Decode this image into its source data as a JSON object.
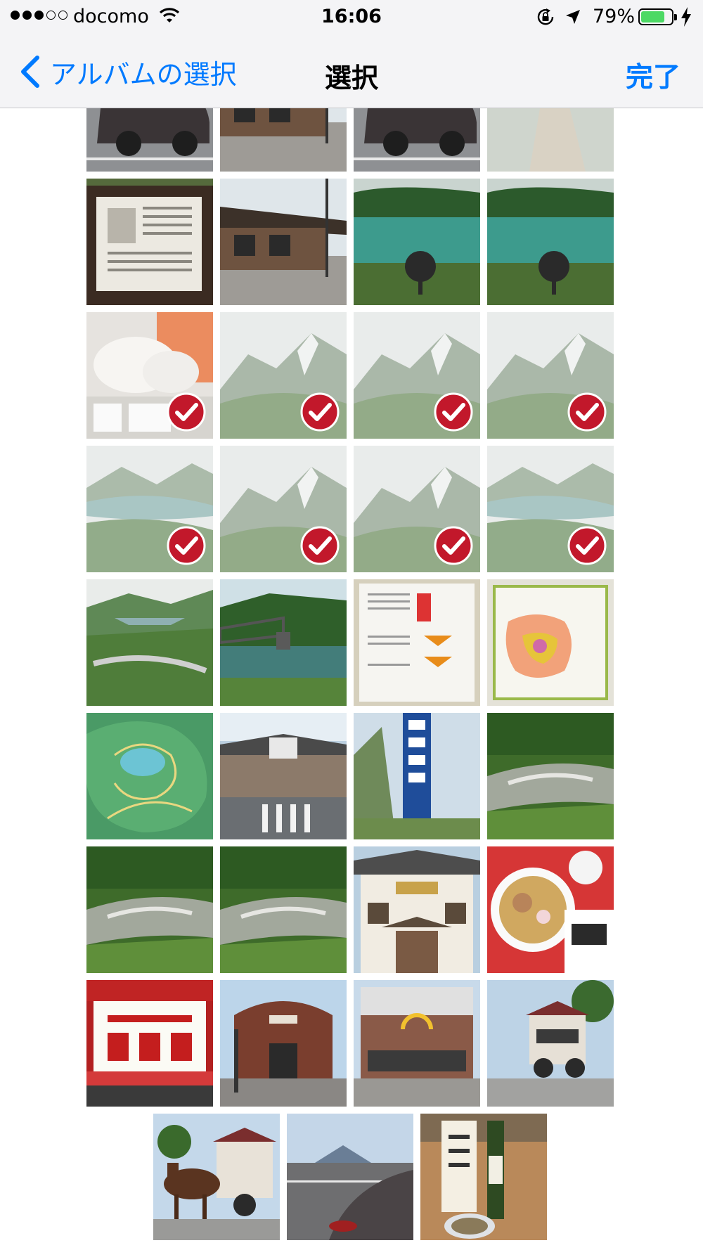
{
  "status_bar": {
    "carrier": "docomo",
    "signal_bars_filled": 3,
    "signal_bars_total": 5,
    "time": "16:06",
    "battery_percent_label": "79%",
    "battery_level": 0.79
  },
  "nav": {
    "back_label": "アルバムの選択",
    "title": "選択",
    "done_label": "完了"
  },
  "colors": {
    "accent": "#007aff",
    "check_badge": "#c2182b",
    "battery_green": "#4cd964"
  },
  "photos": [
    {
      "scene": "car",
      "selected": false
    },
    {
      "scene": "building",
      "selected": false
    },
    {
      "scene": "car",
      "selected": false
    },
    {
      "scene": "path",
      "selected": false
    },
    {
      "scene": "signboard",
      "selected": false
    },
    {
      "scene": "building",
      "selected": false
    },
    {
      "scene": "lake",
      "selected": false
    },
    {
      "scene": "lake",
      "selected": false
    },
    {
      "scene": "bags",
      "selected": true
    },
    {
      "scene": "mountain",
      "selected": true
    },
    {
      "scene": "mountain",
      "selected": true
    },
    {
      "scene": "mountain",
      "selected": true
    },
    {
      "scene": "mountain-lake",
      "selected": true
    },
    {
      "scene": "mountain",
      "selected": true
    },
    {
      "scene": "mountain",
      "selected": true
    },
    {
      "scene": "mountain-lake",
      "selected": true
    },
    {
      "scene": "valley",
      "selected": false
    },
    {
      "scene": "bridge",
      "selected": false
    },
    {
      "scene": "poster",
      "selected": false
    },
    {
      "scene": "map-poster",
      "selected": false
    },
    {
      "scene": "relief-map",
      "selected": false
    },
    {
      "scene": "station",
      "selected": false
    },
    {
      "scene": "tall-sign",
      "selected": false
    },
    {
      "scene": "river",
      "selected": false
    },
    {
      "scene": "river",
      "selected": false
    },
    {
      "scene": "river",
      "selected": false
    },
    {
      "scene": "inn",
      "selected": false
    },
    {
      "scene": "ramen",
      "selected": false
    },
    {
      "scene": "restaurant-sign",
      "selected": false
    },
    {
      "scene": "brick-station",
      "selected": false
    },
    {
      "scene": "shop",
      "selected": false
    },
    {
      "scene": "carriage",
      "selected": false
    },
    {
      "scene": "horse-carriage",
      "selected": false
    },
    {
      "scene": "road-car",
      "selected": false
    },
    {
      "scene": "sake",
      "selected": false
    }
  ]
}
